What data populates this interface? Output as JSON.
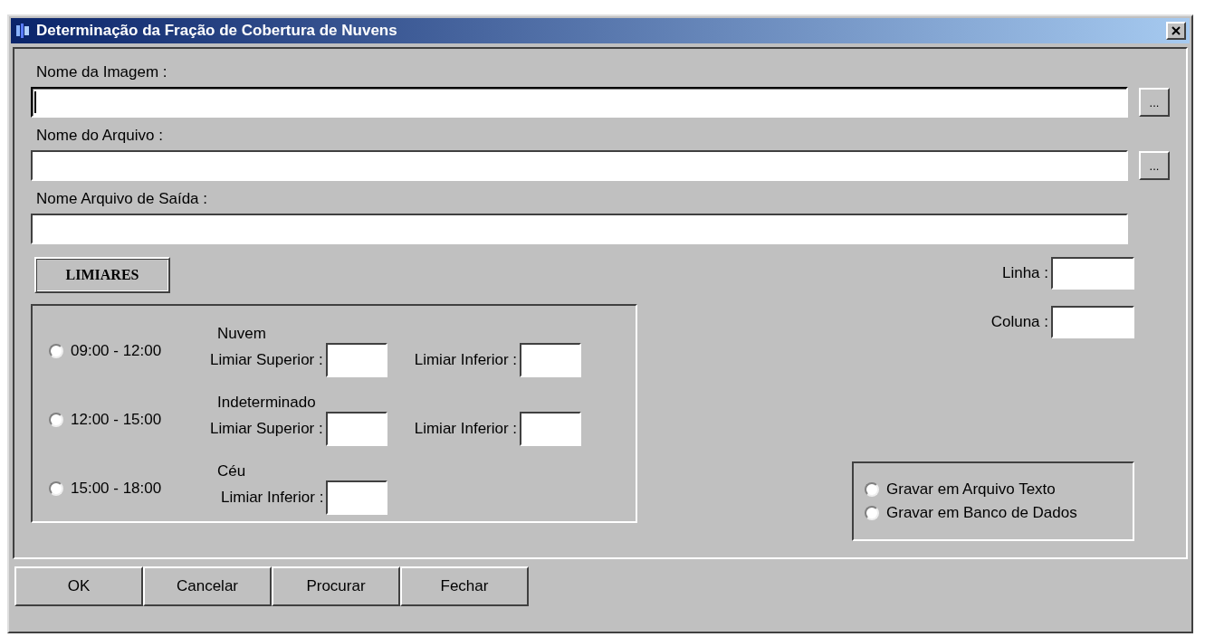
{
  "window": {
    "title": "Determinação da Fração de Cobertura de Nuvens"
  },
  "fields": [
    {
      "label": "Nome da Imagem :",
      "focused": true,
      "browse": "..."
    },
    {
      "label": "Nome do Arquivo :",
      "focused": false,
      "browse": "..."
    },
    {
      "label": "Nome Arquivo de Saída :",
      "focused": false
    }
  ],
  "thresholds": {
    "heading": "LIMIARES",
    "rows": [
      {
        "time": "09:00 - 12:00",
        "selected": false,
        "class": "Nuvem",
        "inputs": [
          "Limiar Superior :",
          "Limiar Inferior :"
        ]
      },
      {
        "time": "12:00 - 15:00",
        "selected": false,
        "class": "Indeterminado",
        "inputs": [
          "Limiar Superior :",
          "Limiar Inferior :"
        ]
      },
      {
        "time": "15:00 - 18:00",
        "selected": false,
        "class": "Céu",
        "inputs": [
          "Limiar Inferior :"
        ]
      }
    ]
  },
  "position": [
    {
      "label": "Linha :"
    },
    {
      "label": "Coluna :"
    }
  ],
  "output": [
    {
      "label": "Gravar em Arquivo Texto",
      "selected": false
    },
    {
      "label": "Gravar em Banco de Dados",
      "selected": false
    }
  ],
  "buttons": [
    "OK",
    "Cancelar",
    "Procurar",
    "Fechar"
  ]
}
